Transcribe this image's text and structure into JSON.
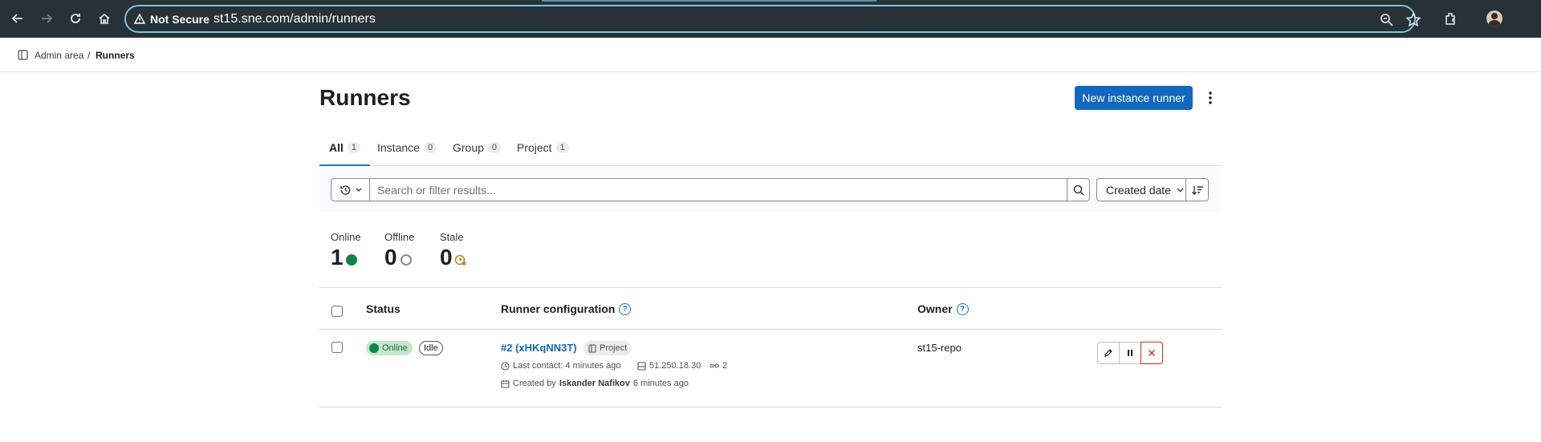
{
  "browser": {
    "security_label": "Not Secure",
    "url": "st15.sne.com/admin/runners"
  },
  "breadcrumb": {
    "items": [
      {
        "label": "Admin area"
      },
      {
        "label": "Runners"
      }
    ],
    "separator": "/"
  },
  "page": {
    "title": "Runners",
    "new_runner_label": "New instance runner"
  },
  "tabs": [
    {
      "label": "All",
      "count": "1"
    },
    {
      "label": "Instance",
      "count": "0"
    },
    {
      "label": "Group",
      "count": "0"
    },
    {
      "label": "Project",
      "count": "1"
    }
  ],
  "filter": {
    "search_placeholder": "Search or filter results...",
    "sort_label": "Created date"
  },
  "stats": [
    {
      "label": "Online",
      "value": "1",
      "icon": "online-dot-icon",
      "color": "#108548"
    },
    {
      "label": "Offline",
      "value": "0",
      "icon": "offline-circle-icon",
      "color": "#89888d"
    },
    {
      "label": "Stale",
      "value": "0",
      "icon": "stale-clock-icon",
      "color": "#c17d10"
    }
  ],
  "table": {
    "headers": {
      "status": "Status",
      "config": "Runner configuration",
      "owner": "Owner"
    },
    "rows": [
      {
        "status": "Online",
        "state": "Idle",
        "runner_name": "#2 (xHKqNN3T)",
        "type_badge": "Project",
        "last_contact": "Last contact: 4 minutes ago",
        "ip": "51.250.18.30",
        "jobs": "2",
        "created_prefix": "Created by",
        "created_by": "Iskander Nafikov",
        "created_ago": "6 minutes ago",
        "owner": "st15-repo"
      }
    ]
  },
  "colors": {
    "chrome_bg": "#263238",
    "primary": "#1068bf",
    "online": "#108548",
    "danger": "#dd2b0e"
  }
}
